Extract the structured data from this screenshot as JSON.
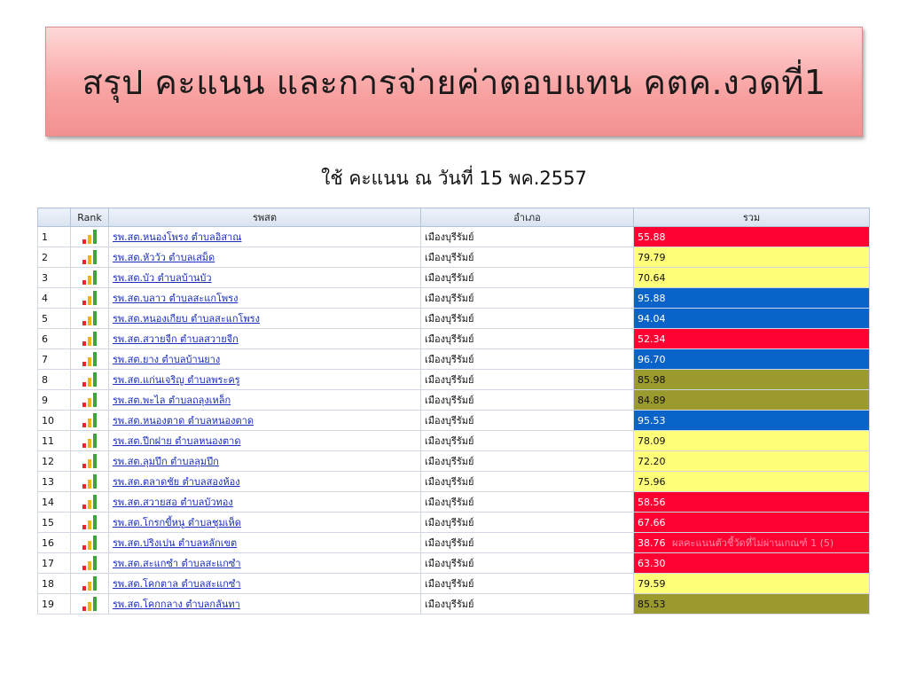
{
  "title": "สรุป คะแนน และการจ่ายค่าตอบแทน คตค.งวดที่1",
  "subtitle": "ใช้ คะแนน ณ วันที่ 15 พค.2557",
  "columns": {
    "num": "",
    "rank": "Rank",
    "name": "รพสต",
    "district": "อำเภอ",
    "total": "รวม"
  },
  "colors": {
    "red": "#ff0033",
    "yellow": "#ffff7a",
    "blue": "#0a63c8",
    "olive": "#9b9a2e"
  },
  "rows": [
    {
      "num": "1",
      "name": "รพ.สต.หนองโพรง ตำบลอิสาณ",
      "district": "เมืองบุรีรัมย์",
      "total": "55.88",
      "color": "#ff0033"
    },
    {
      "num": "2",
      "name": "รพ.สต.หัววัว ตำบลเสม็ด",
      "district": "เมืองบุรีรัมย์",
      "total": "79.79",
      "color": "#ffff7a"
    },
    {
      "num": "3",
      "name": "รพ.สต.บัว ตำบลบ้านบัว",
      "district": "เมืองบุรีรัมย์",
      "total": "70.64",
      "color": "#ffff7a"
    },
    {
      "num": "4",
      "name": "รพ.สต.บลาว ตำบลสะแกโพรง",
      "district": "เมืองบุรีรัมย์",
      "total": "95.88",
      "color": "#0a63c8"
    },
    {
      "num": "5",
      "name": "รพ.สต.หนองเกียบ ตำบลสะแกโพรง",
      "district": "เมืองบุรีรัมย์",
      "total": "94.04",
      "color": "#0a63c8"
    },
    {
      "num": "6",
      "name": "รพ.สต.สวายจีก ตำบลสวายจีก",
      "district": "เมืองบุรีรัมย์",
      "total": "52.34",
      "color": "#ff0033"
    },
    {
      "num": "7",
      "name": "รพ.สต.ยาง ตำบลบ้านยาง",
      "district": "เมืองบุรีรัมย์",
      "total": "96.70",
      "color": "#0a63c8"
    },
    {
      "num": "8",
      "name": "รพ.สต.แก่นเจริญ ตำบลพระครู",
      "district": "เมืองบุรีรัมย์",
      "total": "85.98",
      "color": "#9b9a2e"
    },
    {
      "num": "9",
      "name": "รพ.สต.พะไล ตำบลถลุงเหล็ก",
      "district": "เมืองบุรีรัมย์",
      "total": "84.89",
      "color": "#9b9a2e"
    },
    {
      "num": "10",
      "name": "รพ.สต.หนองตาด ตำบลหนองตาด",
      "district": "เมืองบุรีรัมย์",
      "total": "95.53",
      "color": "#0a63c8"
    },
    {
      "num": "11",
      "name": "รพ.สต.ปีกฝาย ตำบลหนองตาด",
      "district": "เมืองบุรีรัมย์",
      "total": "78.09",
      "color": "#ffff7a"
    },
    {
      "num": "12",
      "name": "รพ.สต.ลุมปึก ตำบลลุมปึก",
      "district": "เมืองบุรีรัมย์",
      "total": "72.20",
      "color": "#ffff7a"
    },
    {
      "num": "13",
      "name": "รพ.สต.ตลาดชัย ตำบลสองห้อง",
      "district": "เมืองบุรีรัมย์",
      "total": "75.96",
      "color": "#ffff7a"
    },
    {
      "num": "14",
      "name": "รพ.สต.สวายสอ ตำบลบัวทอง",
      "district": "เมืองบุรีรัมย์",
      "total": "58.56",
      "color": "#ff0033"
    },
    {
      "num": "15",
      "name": "รพ.สต.โกรกขี้หนู ตำบลชุมเห็ด",
      "district": "เมืองบุรีรัมย์",
      "total": "67.66",
      "color": "#ff0033"
    },
    {
      "num": "16",
      "name": "รพ.สต.ปริงเปน ตำบลหลักเขต",
      "district": "เมืองบุรีรัมย์",
      "total": "38.76",
      "color": "#ff0033",
      "tooltip": "ผลคะแนนตัวชี้วัดที่ไม่ผ่านเกณฑ์ 1 (5)"
    },
    {
      "num": "17",
      "name": "รพ.สต.สะแกซำ ตำบลสะแกซำ",
      "district": "เมืองบุรีรัมย์",
      "total": "63.30",
      "color": "#ff0033"
    },
    {
      "num": "18",
      "name": "รพ.สต.โคกตาล ตำบลสะแกซำ",
      "district": "เมืองบุรีรัมย์",
      "total": "79.59",
      "color": "#ffff7a"
    },
    {
      "num": "19",
      "name": "รพ.สต.โคกกลาง ตำบลกลันทา",
      "district": "เมืองบุรีรัมย์",
      "total": "85.53",
      "color": "#9b9a2e"
    }
  ]
}
